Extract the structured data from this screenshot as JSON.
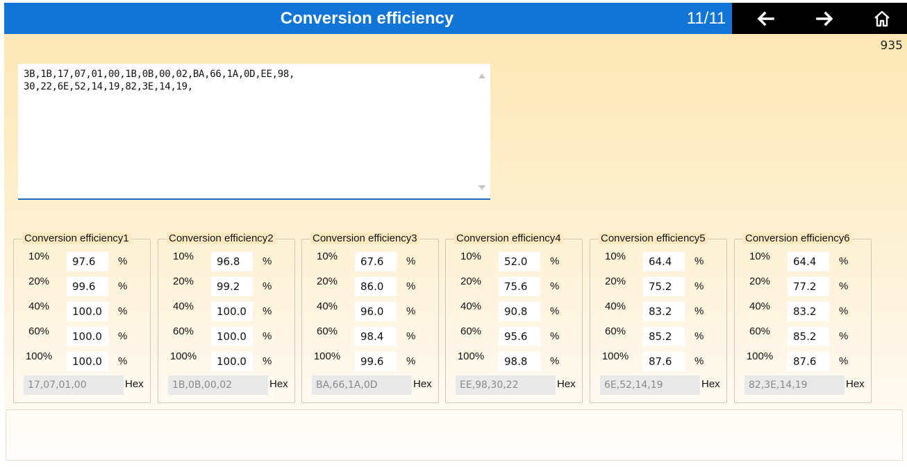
{
  "header": {
    "title": "Conversion efficiency",
    "page_indicator": "11/11",
    "back_icon": "arrow-left-icon",
    "forward_icon": "arrow-right-icon",
    "home_icon": "home-icon"
  },
  "counter": "935",
  "hex_text": "3B,1B,17,07,01,00,1B,0B,00,02,BA,66,1A,0D,EE,98,\n30,22,6E,52,14,19,82,3E,14,19,",
  "groups": [
    {
      "title": "Conversion efficiency1",
      "rows": [
        {
          "label": "10%",
          "value": "97.6",
          "unit": "%"
        },
        {
          "label": "20%",
          "value": "99.6",
          "unit": "%"
        },
        {
          "label": "40%",
          "value": "100.0",
          "unit": "%"
        },
        {
          "label": "60%",
          "value": "100.0",
          "unit": "%"
        },
        {
          "label": "100%",
          "value": "100.0",
          "unit": "%"
        }
      ],
      "hex": "17,07,01,00",
      "hex_unit": "Hex"
    },
    {
      "title": "Conversion efficiency2",
      "rows": [
        {
          "label": "10%",
          "value": "96.8",
          "unit": "%"
        },
        {
          "label": "20%",
          "value": "99.2",
          "unit": "%"
        },
        {
          "label": "40%",
          "value": "100.0",
          "unit": "%"
        },
        {
          "label": "60%",
          "value": "100.0",
          "unit": "%"
        },
        {
          "label": "100%",
          "value": "100.0",
          "unit": "%"
        }
      ],
      "hex": "1B,0B,00,02",
      "hex_unit": "Hex"
    },
    {
      "title": "Conversion efficiency3",
      "rows": [
        {
          "label": "10%",
          "value": "67.6",
          "unit": "%"
        },
        {
          "label": "20%",
          "value": "86.0",
          "unit": "%"
        },
        {
          "label": "40%",
          "value": "96.0",
          "unit": "%"
        },
        {
          "label": "60%",
          "value": "98.4",
          "unit": "%"
        },
        {
          "label": "100%",
          "value": "99.6",
          "unit": "%"
        }
      ],
      "hex": "BA,66,1A,0D",
      "hex_unit": "Hex"
    },
    {
      "title": "Conversion efficiency4",
      "rows": [
        {
          "label": "10%",
          "value": "52.0",
          "unit": "%"
        },
        {
          "label": "20%",
          "value": "75.6",
          "unit": "%"
        },
        {
          "label": "40%",
          "value": "90.8",
          "unit": "%"
        },
        {
          "label": "60%",
          "value": "95.6",
          "unit": "%"
        },
        {
          "label": "100%",
          "value": "98.8",
          "unit": "%"
        }
      ],
      "hex": "EE,98,30,22",
      "hex_unit": "Hex"
    },
    {
      "title": "Conversion efficiency5",
      "rows": [
        {
          "label": "10%",
          "value": "64.4",
          "unit": "%"
        },
        {
          "label": "20%",
          "value": "75.2",
          "unit": "%"
        },
        {
          "label": "40%",
          "value": "83.2",
          "unit": "%"
        },
        {
          "label": "60%",
          "value": "85.2",
          "unit": "%"
        },
        {
          "label": "100%",
          "value": "87.6",
          "unit": "%"
        }
      ],
      "hex": "6E,52,14,19",
      "hex_unit": "Hex"
    },
    {
      "title": "Conversion efficiency6",
      "rows": [
        {
          "label": "10%",
          "value": "64.4",
          "unit": "%"
        },
        {
          "label": "20%",
          "value": "77.2",
          "unit": "%"
        },
        {
          "label": "40%",
          "value": "83.2",
          "unit": "%"
        },
        {
          "label": "60%",
          "value": "85.2",
          "unit": "%"
        },
        {
          "label": "100%",
          "value": "87.6",
          "unit": "%"
        }
      ],
      "hex": "82,3E,14,19",
      "hex_unit": "Hex"
    }
  ],
  "colors": {
    "header_bg": "#1175d8",
    "nav_bg": "#000000",
    "accent_line": "#1b69c7"
  }
}
